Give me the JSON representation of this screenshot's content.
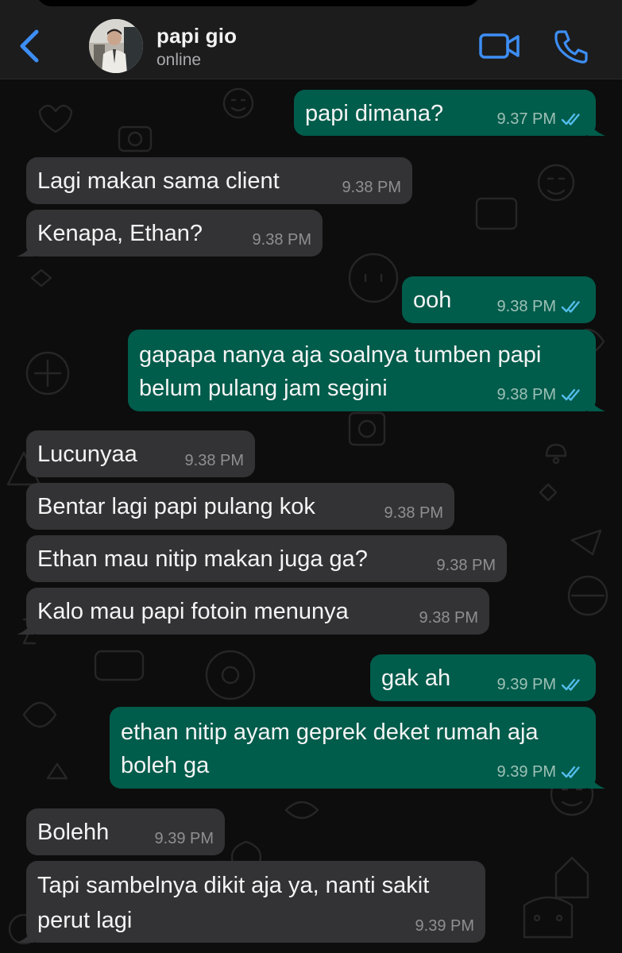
{
  "header": {
    "name": "papi gio",
    "status": "online",
    "back_icon": "chevron-left-icon",
    "video_icon": "video-camera-icon",
    "call_icon": "phone-icon",
    "accent": "#3d8ef5"
  },
  "messages": [
    {
      "direction": "out",
      "text": "papi dimana?",
      "time": "9.37 PM",
      "read": true
    },
    {
      "direction": "in",
      "text": "Lagi makan sama client",
      "time": "9.38 PM"
    },
    {
      "direction": "in",
      "text": "Kenapa, Ethan?",
      "time": "9.38 PM"
    },
    {
      "direction": "out",
      "text": "ooh",
      "time": "9.38 PM",
      "read": true
    },
    {
      "direction": "out",
      "text": "gapapa nanya aja soalnya tumben papi belum pulang jam segini",
      "time": "9.38 PM",
      "read": true
    },
    {
      "direction": "in",
      "text": "Lucunyaa",
      "time": "9.38 PM"
    },
    {
      "direction": "in",
      "text": "Bentar lagi papi pulang kok",
      "time": "9.38 PM"
    },
    {
      "direction": "in",
      "text": "Ethan mau nitip makan juga ga?",
      "time": "9.38 PM"
    },
    {
      "direction": "in",
      "text": "Kalo mau papi fotoin menunya",
      "time": "9.38 PM"
    },
    {
      "direction": "out",
      "text": "gak ah",
      "time": "9.39 PM",
      "read": true
    },
    {
      "direction": "out",
      "text": "ethan nitip ayam geprek deket rumah aja boleh ga",
      "time": "9.39 PM",
      "read": true
    },
    {
      "direction": "in",
      "text": "Bolehh",
      "time": "9.39 PM"
    },
    {
      "direction": "in",
      "text": "Tapi sambelnya dikit aja ya, nanti sakit perut lagi",
      "time": "9.39 PM"
    }
  ],
  "colors": {
    "outgoing_bubble": "#005c4b",
    "incoming_bubble": "#333335",
    "read_ticks": "#53bdeb"
  }
}
